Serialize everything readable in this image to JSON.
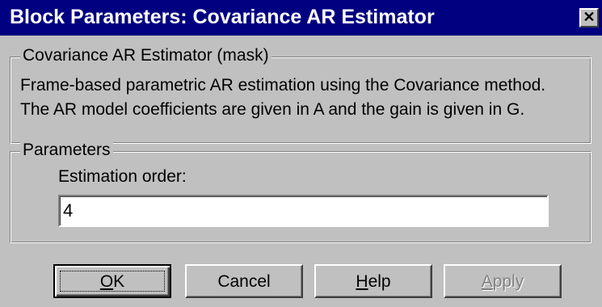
{
  "window": {
    "title": "Block Parameters: Covariance AR Estimator",
    "close_symbol": "✕"
  },
  "mask_group": {
    "legend": "Covariance AR Estimator (mask)",
    "description_line1": "Frame-based parametric AR estimation using the Covariance method.",
    "description_line2": "The AR model coefficients are given in A and the gain is given in G."
  },
  "parameters_group": {
    "legend": "Parameters",
    "estimation_order_label": "Estimation order:",
    "estimation_order_value": "4"
  },
  "buttons": {
    "ok": {
      "pre": "",
      "mnemonic": "O",
      "post": "K"
    },
    "cancel": {
      "label": "Cancel"
    },
    "help": {
      "pre": "",
      "mnemonic": "H",
      "post": "elp"
    },
    "apply": {
      "pre": "",
      "mnemonic": "A",
      "post": "pply"
    }
  }
}
